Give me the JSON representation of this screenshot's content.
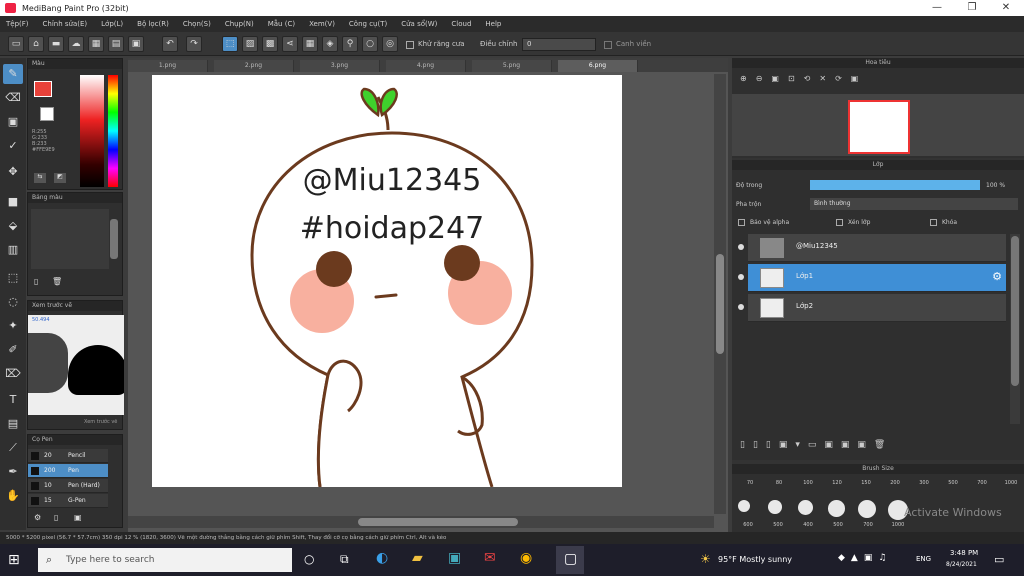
{
  "window": {
    "title": "MediBang Paint Pro (32bit)",
    "min": "—",
    "max": "❐",
    "close": "✕"
  },
  "menu": [
    "Tệp(F)",
    "Chỉnh sửa(E)",
    "Lớp(L)",
    "Bộ lọc(R)",
    "Chọn(S)",
    "Chụp(N)",
    "Mẫu (C)",
    "Xem(V)",
    "Công cụ(T)",
    "Cửa sổ(W)",
    "Cloud",
    "Help"
  ],
  "toolbar": {
    "snap_label": "Khử răng cưa",
    "correction_label": "Điều chỉnh",
    "correction_value": "0",
    "lock_label": "Canh viền"
  },
  "tabs": [
    "1.png",
    "2.png",
    "3.png",
    "4.png",
    "5.png",
    "6.png"
  ],
  "color_panel": {
    "title": "Màu",
    "r": "R:255",
    "g": "G:233",
    "b": "B:233",
    "hex": "#FFE9E9"
  },
  "palette_panel": {
    "title": "Bảng màu"
  },
  "navigator_panel": {
    "title": "Xem trước vẽ",
    "zoom": "50.494",
    "tab_label": "Xem trước vẽ"
  },
  "brush_list": {
    "title": "Cọ Pen",
    "items": [
      {
        "size": "20",
        "name": "Pencil"
      },
      {
        "size": "200",
        "name": "Pen"
      },
      {
        "size": "10",
        "name": "Pen (Hard)"
      },
      {
        "size": "15",
        "name": "G-Pen"
      }
    ]
  },
  "canvas": {
    "line1": "@Miu12345",
    "line2": "#hoidap247"
  },
  "right": {
    "nav_title": "Hoa tiêu",
    "layer_title": "Lớp",
    "opacity_label": "Độ trong",
    "opacity_value": "100 %",
    "opacity": 1.0,
    "blend_label": "Pha trộn",
    "blend_value": "Bình thường",
    "protect_alpha": "Bảo vệ alpha",
    "clipping": "Xén lớp",
    "lock": "Khóa",
    "layers": [
      {
        "name": "@Miu12345",
        "selected": false
      },
      {
        "name": "Lớp1",
        "selected": true
      },
      {
        "name": "Lớp2",
        "selected": false
      }
    ],
    "brush_size_title": "Brush Size",
    "brush_sizes_top": [
      "70",
      "80",
      "100",
      "120",
      "150",
      "200",
      "300",
      "500",
      "700",
      "1000"
    ],
    "brush_sizes_bottom": [
      "600",
      "500",
      "400",
      "500",
      "700",
      "1000"
    ],
    "watermark": "Activate Windows"
  },
  "status": "5000 * 5200 pixel (56.7 * 57.7cm) 350 dpi 12 % (1820, 3600) Vẽ một đường thẳng bằng cách giữ phím Shift, Thay đổi cỡ cọ bằng cách giữ phím Ctrl, Alt và kéo",
  "taskbar": {
    "search_placeholder": "Type here to search",
    "weather": "95°F  Mostly sunny",
    "lang": "ENG",
    "time": "3:48 PM",
    "date": "8/24/2021"
  },
  "colors": {
    "accent": "#4d8ec6",
    "panel": "#2f2f2f",
    "layer_selected": "#3f8fd6",
    "face_outline": "#6b3a1e",
    "blush": "#f7a795",
    "leaf": "#3fd12c"
  }
}
